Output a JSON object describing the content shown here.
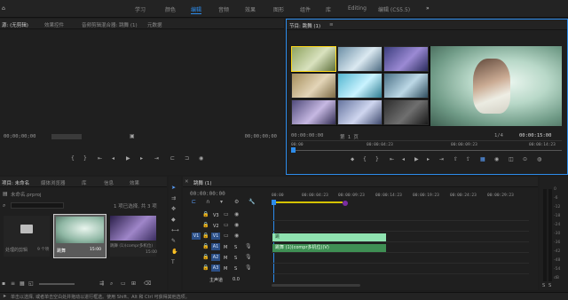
{
  "workspace": {
    "tabs": [
      "学习",
      "颜色",
      "编辑",
      "音频",
      "效果",
      "图形",
      "组件",
      "库",
      "Editing",
      "编辑 (CS5.5)"
    ],
    "active": "编辑",
    "more": "»"
  },
  "source_panel": {
    "tabs": [
      "源: (无剪辑)",
      "效果控件",
      "音频剪辑混合器: 跳舞 (1)",
      "元数据"
    ],
    "menu_icon": "≡",
    "timecode_left": "00;00;00;00",
    "timecode_right": "00;00;00;00"
  },
  "program_panel": {
    "title": "节目: 跳舞 (1)",
    "menu_icon": "≡",
    "timecode": "00:00:00:00",
    "zoom": "第 1 页",
    "fraction": "1/4",
    "duration": "00:00:15:00",
    "ruler": [
      "00:00",
      "00:00:04:23",
      "00:00:09:23",
      "00:00:14:23"
    ],
    "accent": "#2d8ceb"
  },
  "project_panel": {
    "tabs": [
      "项目: 未命名",
      "媒体浏览器",
      "库",
      "信息",
      "效果"
    ],
    "file": "未命名.prproj",
    "selection": "1 项已选择, 共 3 项",
    "items": [
      {
        "name": "处理的剪辑",
        "meta": "9 个项"
      },
      {
        "name": "跳舞",
        "meta": "15:00"
      },
      {
        "name": "跳舞 (1)(compr多机位)",
        "meta": "15:00"
      }
    ]
  },
  "timeline": {
    "title": "跳舞 (1)",
    "timecode": "00:00:00:00",
    "ruler": [
      "00:00",
      "00:00:04:23",
      "00:00:09:23",
      "00:00:14:23",
      "00:00:19:23",
      "00:00:24:23",
      "00:00:29:23"
    ],
    "tracks": [
      {
        "id": "V3",
        "label": "V3"
      },
      {
        "id": "V2",
        "label": "V2"
      },
      {
        "id": "V1",
        "label": "V1"
      },
      {
        "id": "A1",
        "label": "A1"
      },
      {
        "id": "A2",
        "label": "A2"
      },
      {
        "id": "A3",
        "label": "A3"
      },
      {
        "id": "A4",
        "label": "A4"
      }
    ],
    "master": "主声道",
    "master_value": "0.0",
    "video_clip": "跳",
    "audio_clip": "跳舞 (1)(compr多机位)(V)",
    "clip_video_color": "#8fe3b0",
    "clip_audio_color": "#3f8f54"
  },
  "meter": {
    "ticks": [
      "0",
      "-6",
      "-12",
      "-18",
      "-24",
      "-30",
      "-36",
      "-42",
      "-48",
      "-54",
      "dB"
    ],
    "solo": "S",
    "solo2": "S"
  },
  "status": {
    "text": "单击以选择, 或者单击空白处并拖动以进行框选。使用 Shift、Alt 和 Ctrl 可获得其他选项。"
  }
}
